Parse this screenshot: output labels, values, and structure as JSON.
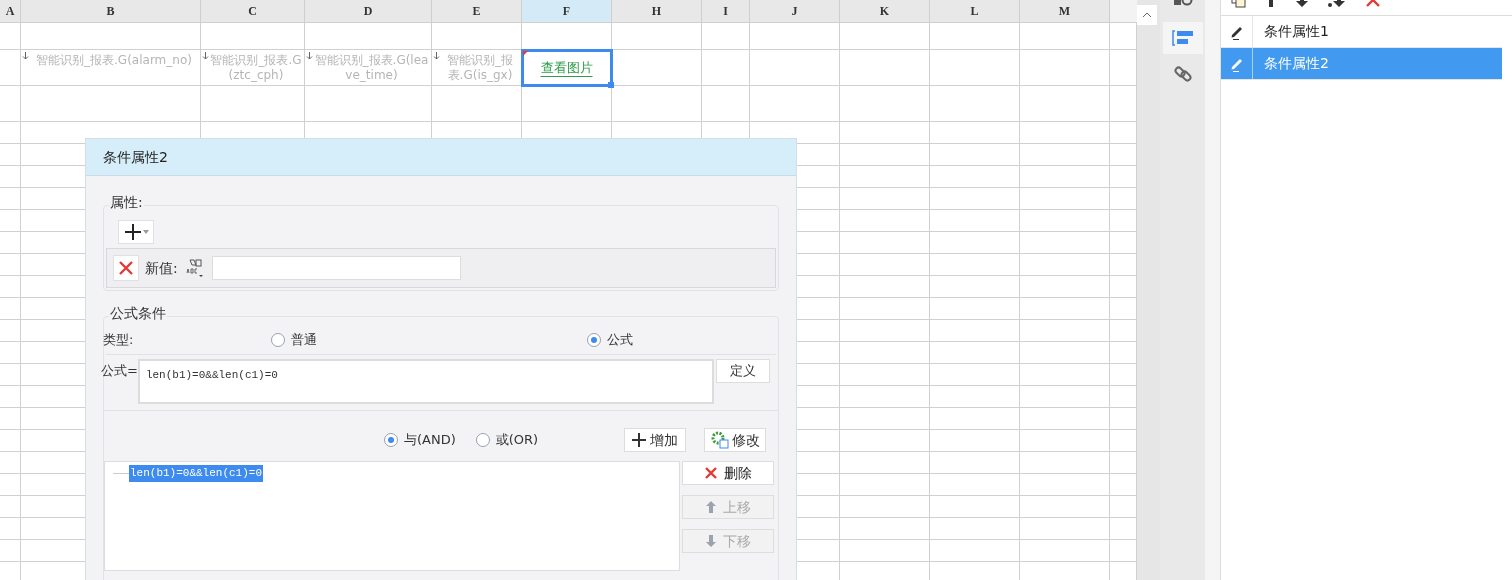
{
  "sheet": {
    "columns": [
      {
        "label": "A",
        "selected": false
      },
      {
        "label": "B",
        "selected": false
      },
      {
        "label": "C",
        "selected": false
      },
      {
        "label": "D",
        "selected": false
      },
      {
        "label": "E",
        "selected": false
      },
      {
        "label": "F",
        "selected": true
      },
      {
        "label": "H",
        "selected": false
      },
      {
        "label": "I",
        "selected": false
      },
      {
        "label": "J",
        "selected": false
      },
      {
        "label": "K",
        "selected": false
      },
      {
        "label": "L",
        "selected": false
      },
      {
        "label": "M",
        "selected": false
      }
    ],
    "cells": [
      {
        "kind": "field",
        "text": "智能识别_报表.G(alarm_no)",
        "selected": false
      },
      {
        "kind": "field",
        "text": "智能识别_报表.G(ztc_cph)",
        "selected": false
      },
      {
        "kind": "field",
        "text": "智能识别_报表.G(leave_time)",
        "selected": false
      },
      {
        "kind": "field",
        "text": "智能识别_报表.G(is_gx)",
        "selected": false
      },
      {
        "kind": "link",
        "text": "查看图片",
        "selected": true
      }
    ]
  },
  "side_tabs": [
    {
      "kind": "data",
      "selected": false
    },
    {
      "kind": "condition",
      "selected": true
    },
    {
      "kind": "hyperlink",
      "selected": false
    }
  ],
  "conditions": [
    {
      "label": "条件属性1",
      "selected": false
    },
    {
      "label": "条件属性2",
      "selected": true
    }
  ],
  "dialog": {
    "title": "条件属性2",
    "attributes": {
      "legend": "属性:",
      "new_value_label": "新值:"
    },
    "formula_condition": {
      "legend": "公式条件",
      "type_label": "类型:",
      "types": [
        {
          "label": "普通",
          "selected": false
        },
        {
          "label": "公式",
          "selected": true
        }
      ],
      "formula_label": "公式=",
      "formula": "len(b1)=0&&len(c1)=0",
      "define_button": "定义",
      "logic": [
        {
          "label": "与(AND)",
          "selected": true
        },
        {
          "label": "或(OR)",
          "selected": false
        }
      ],
      "add_button": "增加",
      "modify_button": "修改",
      "items": [
        {
          "text": "len(b1)=0&&len(c1)=0",
          "selected": true
        }
      ],
      "actions": [
        {
          "kind": "delete",
          "label": "删除",
          "disabled": false
        },
        {
          "kind": "up",
          "label": "上移",
          "disabled": true
        },
        {
          "kind": "down",
          "label": "下移",
          "disabled": true
        }
      ]
    }
  }
}
